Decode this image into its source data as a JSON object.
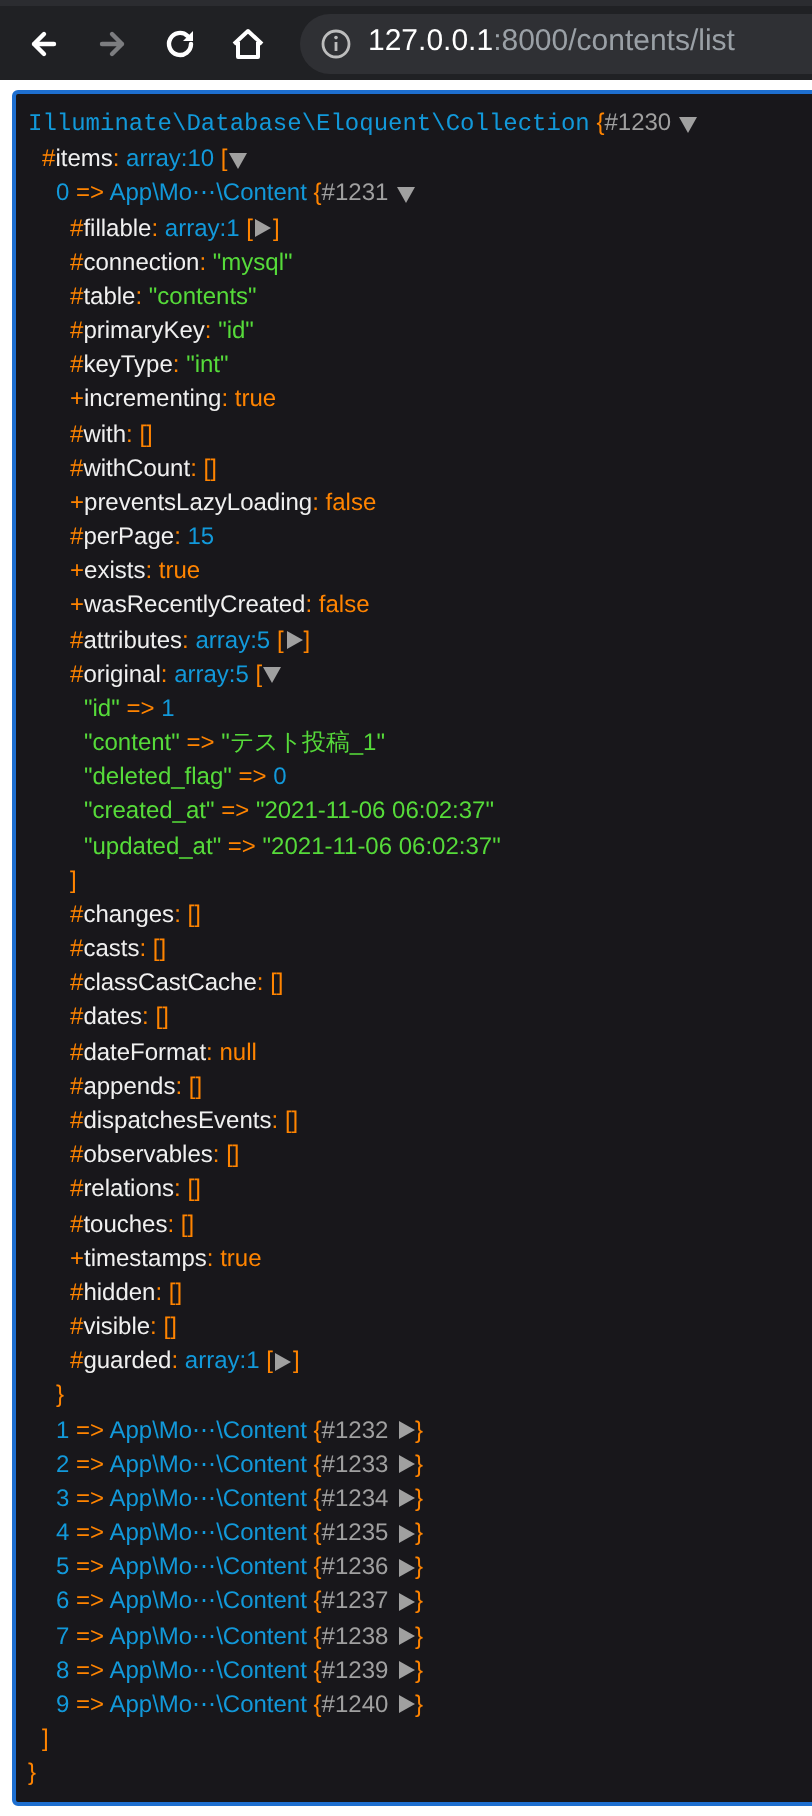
{
  "browser": {
    "nav": [
      {
        "kind": "back",
        "disabled": false
      },
      {
        "kind": "forward",
        "disabled": true
      },
      {
        "kind": "reload",
        "disabled": false
      },
      {
        "kind": "home",
        "disabled": false
      }
    ],
    "url_host": "127.0.0.1",
    "url_rest": ":8000/contents/list"
  },
  "dump": {
    "kind": "root",
    "type_label": "Illuminate\\Database\\Eloquent\\Collection",
    "open": "{",
    "ref": "#1230",
    "expanded": true,
    "close": "}",
    "children": [
      {
        "kind": "prop",
        "sigil": "#",
        "name": "items",
        "sep": ":",
        "type_label": "array:10",
        "open": "[",
        "expanded": true,
        "close": "]",
        "children": [
          {
            "kind": "index",
            "key": "0",
            "sep": "=>",
            "type_label": "App\\Mo⋯\\Content",
            "open": "{",
            "ref": "#1231",
            "expanded": true,
            "close": "}",
            "children": [
              {
                "kind": "prop",
                "sigil": "#",
                "name": "fillable",
                "sep": ":",
                "type_label": "array:1",
                "open": "[",
                "expanded": false,
                "close": "]"
              },
              {
                "kind": "prop",
                "sigil": "#",
                "name": "connection",
                "sep": ":",
                "value": {
                  "kind": "string",
                  "text": "\"mysql\""
                }
              },
              {
                "kind": "prop",
                "sigil": "#",
                "name": "table",
                "sep": ":",
                "value": {
                  "kind": "string",
                  "text": "\"contents\""
                }
              },
              {
                "kind": "prop",
                "sigil": "#",
                "name": "primaryKey",
                "sep": ":",
                "value": {
                  "kind": "string",
                  "text": "\"id\""
                }
              },
              {
                "kind": "prop",
                "sigil": "#",
                "name": "keyType",
                "sep": ":",
                "value": {
                  "kind": "string",
                  "text": "\"int\""
                }
              },
              {
                "kind": "prop",
                "sigil": "+",
                "name": "incrementing",
                "sep": ":",
                "value": {
                  "kind": "const",
                  "text": "true"
                }
              },
              {
                "kind": "prop",
                "sigil": "#",
                "name": "with",
                "sep": ":",
                "value": {
                  "kind": "const",
                  "text": "[]"
                }
              },
              {
                "kind": "prop",
                "sigil": "#",
                "name": "withCount",
                "sep": ":",
                "value": {
                  "kind": "const",
                  "text": "[]"
                }
              },
              {
                "kind": "prop",
                "sigil": "+",
                "name": "preventsLazyLoading",
                "sep": ":",
                "value": {
                  "kind": "const",
                  "text": "false"
                }
              },
              {
                "kind": "prop",
                "sigil": "#",
                "name": "perPage",
                "sep": ":",
                "value": {
                  "kind": "number",
                  "text": "15"
                }
              },
              {
                "kind": "prop",
                "sigil": "+",
                "name": "exists",
                "sep": ":",
                "value": {
                  "kind": "const",
                  "text": "true"
                }
              },
              {
                "kind": "prop",
                "sigil": "+",
                "name": "wasRecentlyCreated",
                "sep": ":",
                "value": {
                  "kind": "const",
                  "text": "false"
                }
              },
              {
                "kind": "prop",
                "sigil": "#",
                "name": "attributes",
                "sep": ":",
                "type_label": "array:5",
                "open": "[",
                "expanded": false,
                "close": "]"
              },
              {
                "kind": "prop",
                "sigil": "#",
                "name": "original",
                "sep": ":",
                "type_label": "array:5",
                "open": "[",
                "expanded": true,
                "close": "]",
                "children": [
                  {
                    "kind": "hash",
                    "key": "\"id\"",
                    "sep": "=>",
                    "value": {
                      "kind": "number",
                      "text": "1"
                    }
                  },
                  {
                    "kind": "hash",
                    "key": "\"content\"",
                    "sep": "=>",
                    "value": {
                      "kind": "string",
                      "text": "\"テスト投稿_1\""
                    }
                  },
                  {
                    "kind": "hash",
                    "key": "\"deleted_flag\"",
                    "sep": "=>",
                    "value": {
                      "kind": "number",
                      "text": "0"
                    }
                  },
                  {
                    "kind": "hash",
                    "key": "\"created_at\"",
                    "sep": "=>",
                    "value": {
                      "kind": "string",
                      "text": "\"2021-11-06 06:02:37\""
                    }
                  },
                  {
                    "kind": "hash",
                    "key": "\"updated_at\"",
                    "sep": "=>",
                    "value": {
                      "kind": "string",
                      "text": "\"2021-11-06 06:02:37\""
                    }
                  }
                ]
              },
              {
                "kind": "prop",
                "sigil": "#",
                "name": "changes",
                "sep": ":",
                "value": {
                  "kind": "const",
                  "text": "[]"
                }
              },
              {
                "kind": "prop",
                "sigil": "#",
                "name": "casts",
                "sep": ":",
                "value": {
                  "kind": "const",
                  "text": "[]"
                }
              },
              {
                "kind": "prop",
                "sigil": "#",
                "name": "classCastCache",
                "sep": ":",
                "value": {
                  "kind": "const",
                  "text": "[]"
                }
              },
              {
                "kind": "prop",
                "sigil": "#",
                "name": "dates",
                "sep": ":",
                "value": {
                  "kind": "const",
                  "text": "[]"
                }
              },
              {
                "kind": "prop",
                "sigil": "#",
                "name": "dateFormat",
                "sep": ":",
                "value": {
                  "kind": "const",
                  "text": "null"
                }
              },
              {
                "kind": "prop",
                "sigil": "#",
                "name": "appends",
                "sep": ":",
                "value": {
                  "kind": "const",
                  "text": "[]"
                }
              },
              {
                "kind": "prop",
                "sigil": "#",
                "name": "dispatchesEvents",
                "sep": ":",
                "value": {
                  "kind": "const",
                  "text": "[]"
                }
              },
              {
                "kind": "prop",
                "sigil": "#",
                "name": "observables",
                "sep": ":",
                "value": {
                  "kind": "const",
                  "text": "[]"
                }
              },
              {
                "kind": "prop",
                "sigil": "#",
                "name": "relations",
                "sep": ":",
                "value": {
                  "kind": "const",
                  "text": "[]"
                }
              },
              {
                "kind": "prop",
                "sigil": "#",
                "name": "touches",
                "sep": ":",
                "value": {
                  "kind": "const",
                  "text": "[]"
                }
              },
              {
                "kind": "prop",
                "sigil": "+",
                "name": "timestamps",
                "sep": ":",
                "value": {
                  "kind": "const",
                  "text": "true"
                }
              },
              {
                "kind": "prop",
                "sigil": "#",
                "name": "hidden",
                "sep": ":",
                "value": {
                  "kind": "const",
                  "text": "[]"
                }
              },
              {
                "kind": "prop",
                "sigil": "#",
                "name": "visible",
                "sep": ":",
                "value": {
                  "kind": "const",
                  "text": "[]"
                }
              },
              {
                "kind": "prop",
                "sigil": "#",
                "name": "guarded",
                "sep": ":",
                "type_label": "array:1",
                "open": "[",
                "expanded": false,
                "close": "]"
              }
            ]
          },
          {
            "kind": "index",
            "key": "1",
            "sep": "=>",
            "type_label": "App\\Mo⋯\\Content",
            "open": "{",
            "ref": "#1232",
            "expanded": false,
            "close": "}"
          },
          {
            "kind": "index",
            "key": "2",
            "sep": "=>",
            "type_label": "App\\Mo⋯\\Content",
            "open": "{",
            "ref": "#1233",
            "expanded": false,
            "close": "}"
          },
          {
            "kind": "index",
            "key": "3",
            "sep": "=>",
            "type_label": "App\\Mo⋯\\Content",
            "open": "{",
            "ref": "#1234",
            "expanded": false,
            "close": "}"
          },
          {
            "kind": "index",
            "key": "4",
            "sep": "=>",
            "type_label": "App\\Mo⋯\\Content",
            "open": "{",
            "ref": "#1235",
            "expanded": false,
            "close": "}"
          },
          {
            "kind": "index",
            "key": "5",
            "sep": "=>",
            "type_label": "App\\Mo⋯\\Content",
            "open": "{",
            "ref": "#1236",
            "expanded": false,
            "close": "}"
          },
          {
            "kind": "index",
            "key": "6",
            "sep": "=>",
            "type_label": "App\\Mo⋯\\Content",
            "open": "{",
            "ref": "#1237",
            "expanded": false,
            "close": "}"
          },
          {
            "kind": "index",
            "key": "7",
            "sep": "=>",
            "type_label": "App\\Mo⋯\\Content",
            "open": "{",
            "ref": "#1238",
            "expanded": false,
            "close": "}"
          },
          {
            "kind": "index",
            "key": "8",
            "sep": "=>",
            "type_label": "App\\Mo⋯\\Content",
            "open": "{",
            "ref": "#1239",
            "expanded": false,
            "close": "}"
          },
          {
            "kind": "index",
            "key": "9",
            "sep": "=>",
            "type_label": "App\\Mo⋯\\Content",
            "open": "{",
            "ref": "#1240",
            "expanded": false,
            "close": "}"
          }
        ]
      }
    ]
  }
}
